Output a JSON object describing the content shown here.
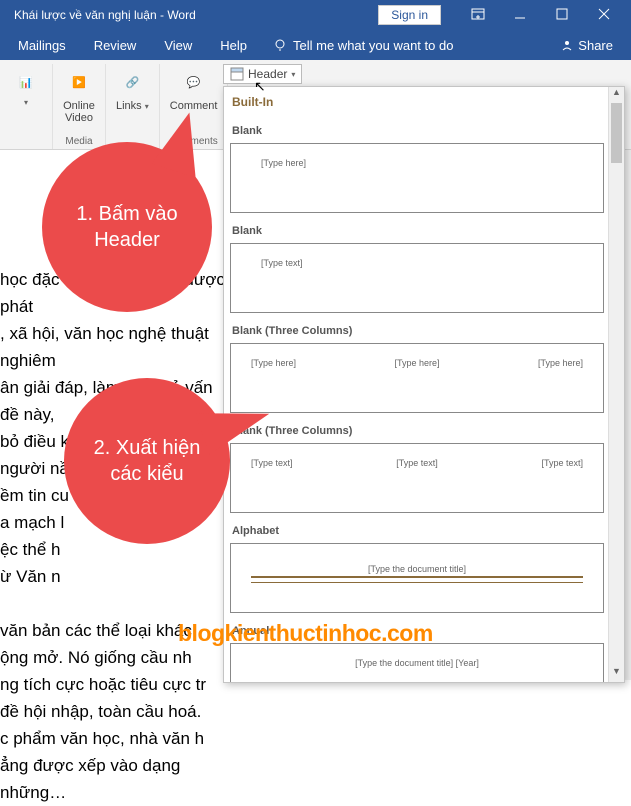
{
  "titlebar": {
    "doc_title": "Khái lược về văn nghị luận  -  Word",
    "signin": "Sign in"
  },
  "tabs": {
    "items": [
      "Mailings",
      "Review",
      "View",
      "Help"
    ],
    "tellme": "Tell me what you want to do",
    "share": "Share"
  },
  "ribbon": {
    "online_video": "Online\nVideo",
    "media": "Media",
    "links": "Links",
    "comment": "Comment",
    "comments": "Comments",
    "header": "Header"
  },
  "gallery": {
    "builtin": "Built-In",
    "items": [
      {
        "label": "Blank",
        "mode": "one",
        "ph": "[Type here]"
      },
      {
        "label": "Blank",
        "mode": "one",
        "ph": "[Type text]"
      },
      {
        "label": "Blank (Three Columns)",
        "mode": "three",
        "ph": "[Type here]"
      },
      {
        "label": "Blank (Three Columns)",
        "mode": "three",
        "ph": "[Type text]"
      },
      {
        "label": "Alphabet",
        "mode": "alpha",
        "ph": "[Type the document title]"
      },
      {
        "label": "Annual",
        "mode": "annual",
        "ph": "[Type the document title] [Year]"
      }
    ]
  },
  "callouts": {
    "c1": "1. Bấm vào Header",
    "c2": "2. Xuất hiện các kiểu"
  },
  "doc_lines": [
    "học đặc biệt đứng vững được, phát",
    ", xã hội, văn học nghệ thuật nghiêm",
    "ân giải đáp, làm sáng tỏ vấn đề này,",
    "bỏ điều kia, để đánh giá người nầy, ý",
    "ềm tin cu",
    "a mạch l",
    "ệc thể h",
    "ừ Văn n",
    "",
    "văn bản các thể loại khác",
    "ộng mở. Nó giống cầu nh",
    "ng tích cực hoặc tiêu cực tr",
    "đề hội nhập, toàn cầu hoá.",
    "c phẩm văn học, nhà văn h",
    "ẳng được xếp vào dạng những…"
  ],
  "watermark": "blogkienthuctinhoc.com"
}
